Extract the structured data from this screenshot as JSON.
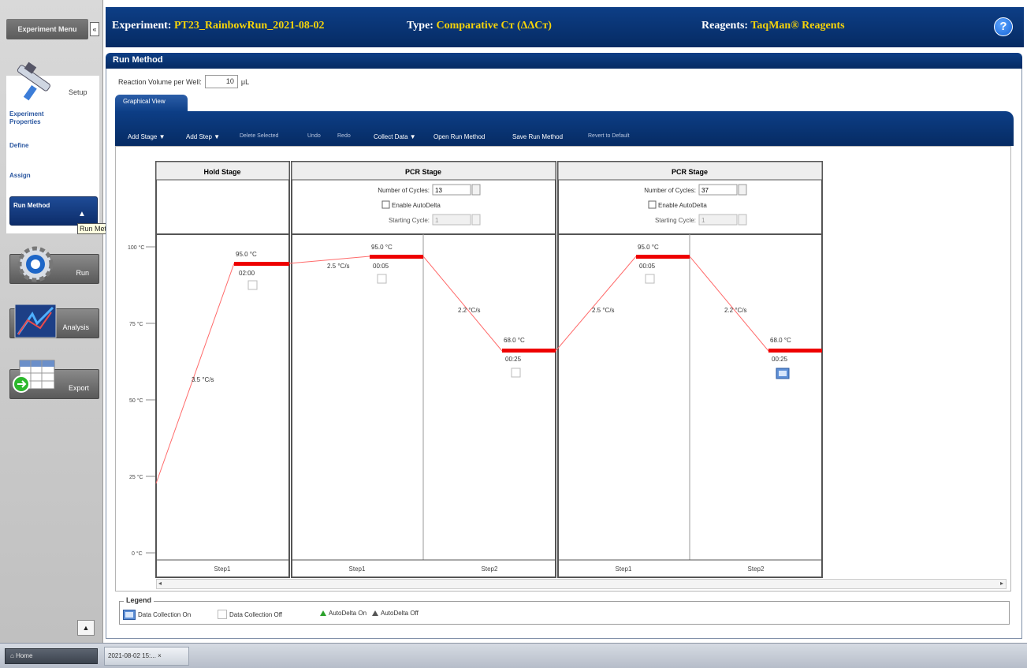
{
  "header": {
    "experiment_key": "Experiment:",
    "experiment_value": "PT23_RainbowRun_2021-08-02",
    "type_key": "Type:",
    "type_value": "Comparative Cт (ΔΔCт)",
    "reagents_key": "Reagents:",
    "reagents_value": "TaqMan® Reagents",
    "help_icon": "?"
  },
  "sidebar": {
    "nav_header": "Experiment Menu",
    "collapse": "«",
    "setup_label": "Setup",
    "links": [
      "Experiment Properties",
      "Define",
      "Assign"
    ],
    "run_method": "Run Method",
    "tooltip": "Run Method",
    "run": "Run",
    "analysis": "Analysis",
    "export": "Export",
    "scroll_up": "▲"
  },
  "panel": {
    "title": "Run Method",
    "volume_label": "Reaction Volume per Well:",
    "volume_value": "10",
    "volume_unit": "μL",
    "tab_graphical": "Graphical View"
  },
  "toolbar": {
    "add_stage": "Add Stage ▼",
    "add_step": "Add Step ▼",
    "delete_selected": "Delete Selected",
    "undo": "Undo",
    "redo": "Redo",
    "collect_data": "Collect Data ▼",
    "open_run_method": "Open Run Method",
    "save_run_method": "Save Run Method",
    "revert_default": "Revert to Default"
  },
  "stages": [
    {
      "name": "Hold Stage",
      "steps": [
        {
          "label": "Step1",
          "temp": "95.0 °C",
          "time": "02:00",
          "ramp": "3.5 °C/s",
          "collect": false
        }
      ]
    },
    {
      "name": "PCR Stage",
      "cycles_label": "Number of Cycles:",
      "cycles": "13",
      "autodelta_label": "Enable AutoDelta",
      "start_cycle_label": "Starting Cycle:",
      "start_cycle": "1",
      "steps": [
        {
          "label": "Step1",
          "temp": "95.0 °C",
          "time": "00:05",
          "ramp": "2.5 °C/s",
          "collect": false
        },
        {
          "label": "Step2",
          "temp": "68.0 °C",
          "time": "00:25",
          "ramp": "2.2 °C/s",
          "collect": false
        }
      ]
    },
    {
      "name": "PCR Stage",
      "cycles_label": "Number of Cycles:",
      "cycles": "37",
      "autodelta_label": "Enable AutoDelta",
      "start_cycle_label": "Starting Cycle:",
      "start_cycle": "1",
      "steps": [
        {
          "label": "Step1",
          "temp": "95.0 °C",
          "time": "00:05",
          "ramp": "2.5 °C/s",
          "collect": false
        },
        {
          "label": "Step2",
          "temp": "68.0 °C",
          "time": "00:25",
          "ramp": "2.2 °C/s",
          "collect": true
        }
      ]
    }
  ],
  "yaxis": [
    "100 °C",
    "75 °C",
    "50 °C",
    "25 °C",
    "0 °C"
  ],
  "legend": {
    "title": "Legend",
    "collection_on": "Data Collection On",
    "collection_off": "Data Collection Off",
    "autodelta_on": "AutoDelta On",
    "autodelta_off": "AutoDelta Off"
  },
  "taskbar": {
    "home": "Home",
    "doc": "2021-08-02 15:..."
  },
  "colors": {
    "header_bg": "#0d3e86",
    "header_value": "#f5d30a",
    "hold_line": "#ff0000",
    "ramp_line": "#ff6b6b"
  }
}
